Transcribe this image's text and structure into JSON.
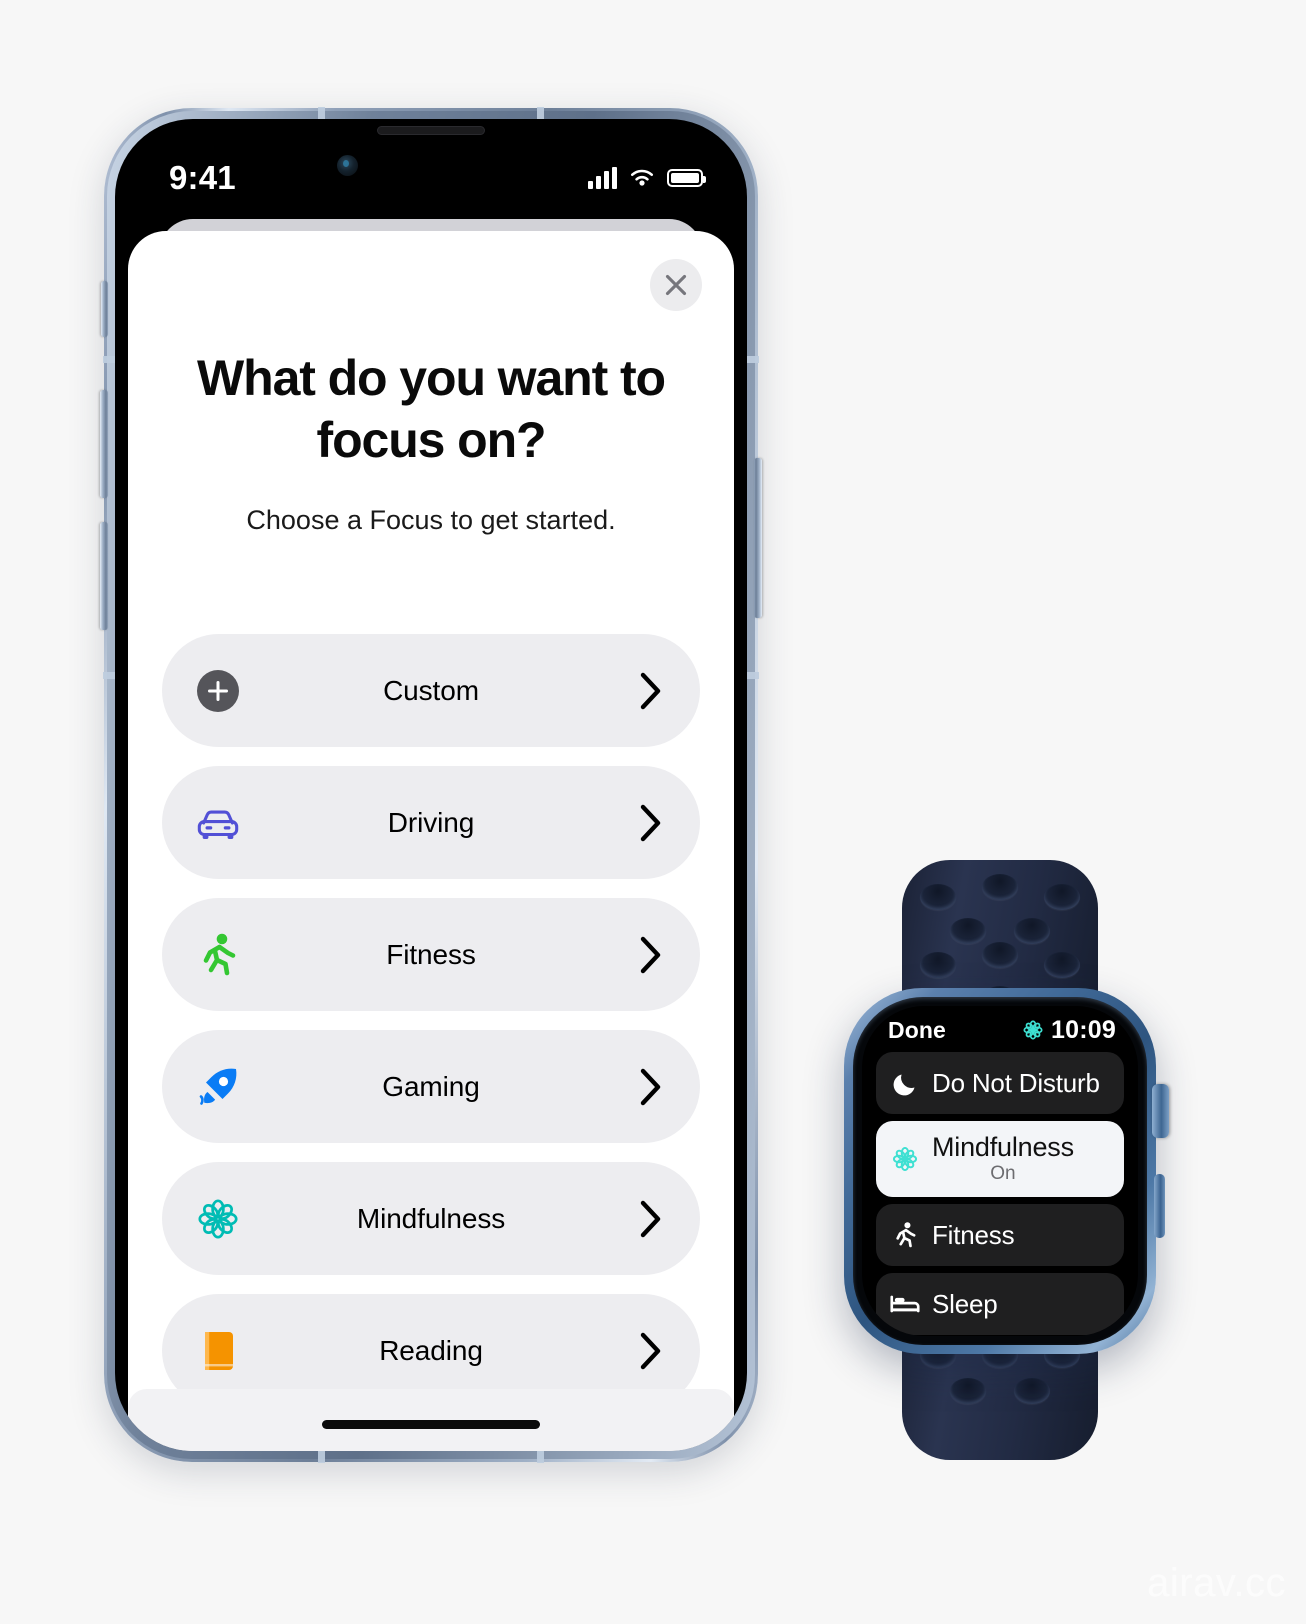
{
  "page": {
    "background_color": "#f7f7f7",
    "watermark": "airav.cc"
  },
  "phone": {
    "status_bar": {
      "time": "9:41",
      "cellular_icon": "cellular-bars-icon",
      "wifi_icon": "wifi-icon",
      "battery_icon": "battery-full-icon"
    },
    "sheet": {
      "close_icon": "close-x-icon",
      "headline": "What do you want to focus on?",
      "subhead": "Choose a Focus to get started.",
      "focus_options": [
        {
          "label": "Custom",
          "icon": "plus-circle-icon",
          "color": "#55555a",
          "chevron": "chevron-right-icon"
        },
        {
          "label": "Driving",
          "icon": "car-icon",
          "color": "#5250d6",
          "chevron": "chevron-right-icon"
        },
        {
          "label": "Fitness",
          "icon": "running-figure-icon",
          "color": "#34c732",
          "chevron": "chevron-right-icon"
        },
        {
          "label": "Gaming",
          "icon": "rocket-icon",
          "color": "#0a7cf5",
          "chevron": "chevron-right-icon"
        },
        {
          "label": "Mindfulness",
          "icon": "flower-icon",
          "color": "#00bcb4",
          "chevron": "chevron-right-icon"
        },
        {
          "label": "Reading",
          "icon": "book-icon",
          "color": "#f59300",
          "chevron": "chevron-right-icon"
        }
      ],
      "home_indicator": "home-indicator"
    }
  },
  "watch": {
    "status_bar": {
      "done_label": "Done",
      "focus_icon": "mindfulness-flower-icon",
      "time": "10:09"
    },
    "focus_rows": [
      {
        "label": "Do Not Disturb",
        "subtitle": "",
        "icon": "moon-icon",
        "selected": false
      },
      {
        "label": "Mindfulness",
        "subtitle": "On",
        "icon": "flower-icon",
        "selected": true
      },
      {
        "label": "Fitness",
        "subtitle": "",
        "icon": "running-figure-icon",
        "selected": false
      },
      {
        "label": "Sleep",
        "subtitle": "",
        "icon": "bed-icon",
        "selected": false
      }
    ]
  }
}
